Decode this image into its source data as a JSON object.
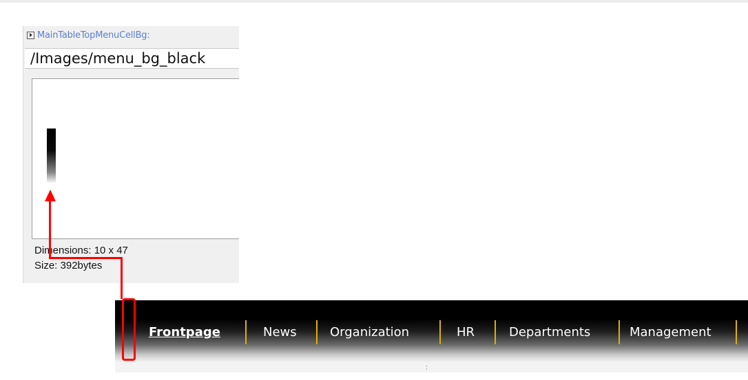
{
  "property": {
    "name": "MainTableTopMenuCellBg:",
    "value": "/Images/menu_bg_black",
    "dimensions": "Dimensions: 10 x 47",
    "size": "Size: 392bytes"
  },
  "menu": {
    "items": [
      {
        "label": "Frontpage",
        "active": true
      },
      {
        "label": "News"
      },
      {
        "label": "Organization"
      },
      {
        "label": "HR"
      },
      {
        "label": "Departments"
      },
      {
        "label": "Management"
      }
    ],
    "separator_color": "#e0b100"
  },
  "annotation": {
    "color": "#ff0000"
  }
}
